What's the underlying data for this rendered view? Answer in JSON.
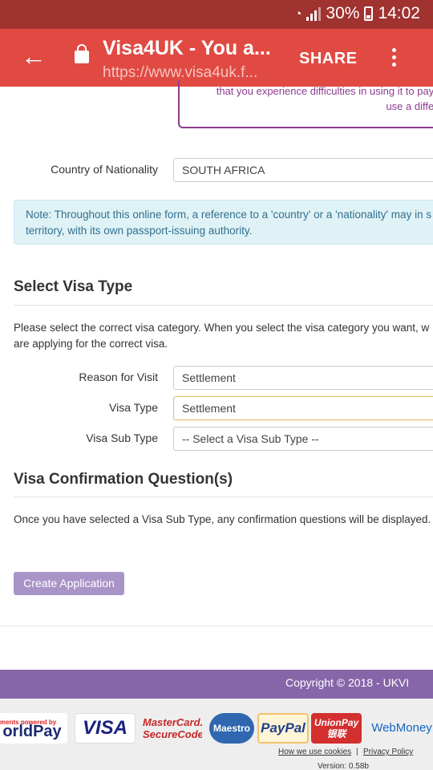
{
  "status_bar": {
    "battery": "30%",
    "time": "14:02"
  },
  "browser": {
    "back_icon": "arrow-left-icon",
    "lock_icon": "lock-icon",
    "title": "Visa4UK - You a...",
    "url": "https://www.visa4uk.f...",
    "share_label": "SHARE",
    "menu_icon": "more-vert-icon"
  },
  "notice": {
    "line1": "that you experience difficulties in using it to pay for",
    "line2": "use a differen"
  },
  "nationality": {
    "label": "Country of Nationality",
    "value": "SOUTH AFRICA"
  },
  "info_box": {
    "line1": "Note: Throughout this online form, a reference to a 'country' or a 'nationality' may in s",
    "line2": "territory, with its own passport-issuing authority."
  },
  "select_visa": {
    "heading": "Select Visa Type",
    "text_line1": "Please select the correct visa category. When you select the visa category you want, w",
    "text_line2": "are applying for the correct visa.",
    "reason_label": "Reason for Visit",
    "reason_value": "Settlement",
    "type_label": "Visa Type",
    "type_value": "Settlement",
    "subtype_label": "Visa Sub Type",
    "subtype_value": "-- Select a Visa Sub Type --"
  },
  "confirmation": {
    "heading": "Visa Confirmation Question(s)",
    "text": "Once you have selected a Visa Sub Type, any confirmation questions will be displayed."
  },
  "create_button": "Create Application",
  "footer": {
    "copyright": "Copyright © 2018 - UKVI",
    "payments": {
      "worldpay_small": "ments powered by",
      "worldpay": "orldPay",
      "visa": "VISA",
      "mastercard_1": "MasterCard.",
      "mastercard_2": "SecureCode.",
      "maestro": "Maestro",
      "paypal": "PayPal",
      "unionpay_1": "UnionPay",
      "unionpay_2": "银联",
      "webmoney": "WebMoney"
    },
    "cookies_link": "How we use cookies",
    "separator": "|",
    "privacy_link": "Privacy Policy",
    "version": "Version: 0.58b"
  }
}
